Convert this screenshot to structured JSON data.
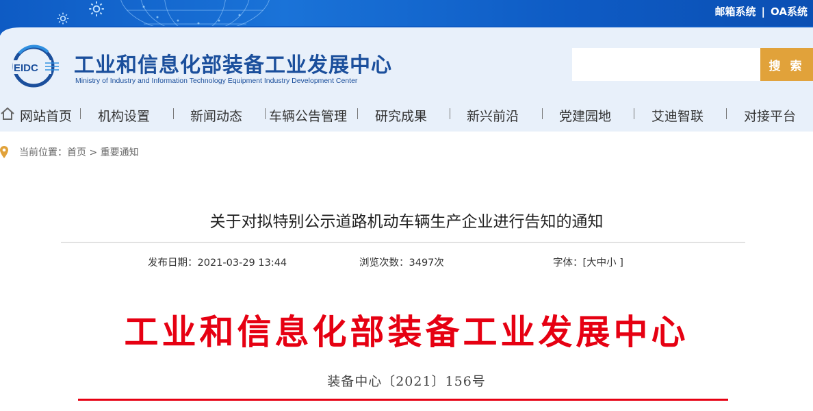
{
  "topbar": {
    "links": [
      "邮箱系统",
      "OA系统"
    ],
    "separator": "|"
  },
  "header": {
    "logo_text": "EIDC",
    "title_cn": "工业和信息化部装备工业发展中心",
    "title_en": "Ministry of Industry and Information Technology Equipment Industry Development Center",
    "search": {
      "placeholder": "",
      "button_label": "搜 索"
    }
  },
  "nav": {
    "items": [
      "网站首页",
      "机构设置",
      "新闻动态",
      "车辆公告管理",
      "研究成果",
      "新兴前沿",
      "党建园地",
      "艾迪智联",
      "对接平台"
    ]
  },
  "breadcrumb": {
    "prefix": "当前位置：",
    "home": "首页",
    "arrow": " > ",
    "current": "重要通知"
  },
  "article": {
    "title": "关于对拟特别公示道路机动车辆生产企业进行告知的通知",
    "date_label": "发布日期：2021-03-29 13:44",
    "views_label": "浏览次数：3497次",
    "font_label": "字体：",
    "font_open": "[",
    "font_big": "大",
    "font_mid": "中",
    "font_small": "小",
    "font_close": " ]",
    "doc_header": "工业和信息化部装备工业发展中心",
    "doc_number": "装备中心〔2021〕156号"
  },
  "colors": {
    "topbar": "#0e5bc4",
    "header_bg": "#e8f0fa",
    "brand_blue": "#1b4f9c",
    "search_button": "#e1a23a",
    "doc_red": "#e60012"
  }
}
